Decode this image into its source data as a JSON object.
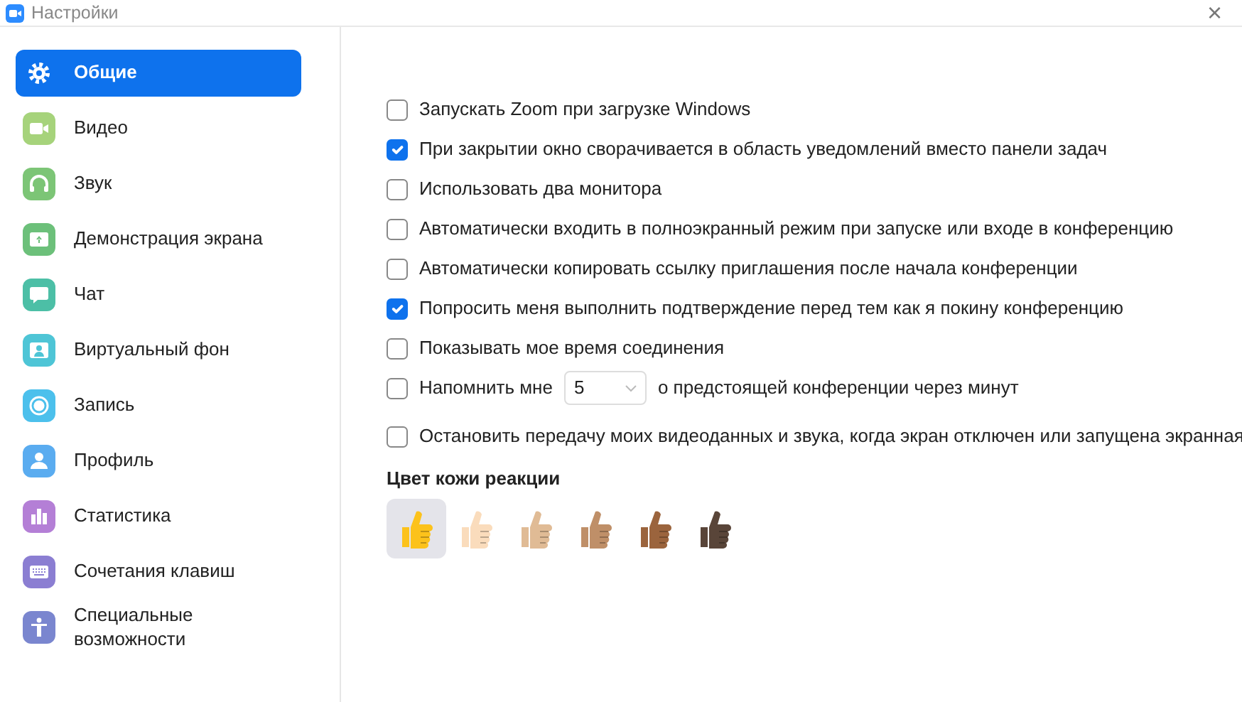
{
  "window": {
    "title": "Настройки",
    "close": "×"
  },
  "sidebar": {
    "items": [
      {
        "label": "Общие",
        "color": "#0e72ed",
        "selected": true
      },
      {
        "label": "Видео",
        "color": "#a6d37b",
        "selected": false
      },
      {
        "label": "Звук",
        "color": "#7cc576",
        "selected": false
      },
      {
        "label": "Демонстрация экрана",
        "color": "#6cc07a",
        "selected": false
      },
      {
        "label": "Чат",
        "color": "#4cbfa6",
        "selected": false
      },
      {
        "label": "Виртуальный фон",
        "color": "#4ec5d6",
        "selected": false
      },
      {
        "label": "Запись",
        "color": "#4cc0ec",
        "selected": false
      },
      {
        "label": "Профиль",
        "color": "#5aacf0",
        "selected": false
      },
      {
        "label": "Статистика",
        "color": "#b47fd6",
        "selected": false
      },
      {
        "label": "Сочетания клавиш",
        "color": "#8b7ed2",
        "selected": false
      },
      {
        "label": "Специальные возможности",
        "color": "#7a86cf",
        "selected": false
      }
    ]
  },
  "options": [
    {
      "kind": "check",
      "label": "Запускать Zoom при загрузке Windows",
      "checked": false
    },
    {
      "kind": "check",
      "label": "При закрытии окно сворачивается в область уведомлений вместо панели задач",
      "checked": true
    },
    {
      "kind": "check",
      "label": "Использовать два монитора",
      "checked": false
    },
    {
      "kind": "check",
      "label": "Автоматически входить в полноэкранный режим при запуске или входе в конференцию",
      "checked": false
    },
    {
      "kind": "check",
      "label": "Автоматически копировать ссылку приглашения после начала конференции",
      "checked": false
    },
    {
      "kind": "check",
      "label": "Попросить меня выполнить подтверждение перед тем как я покину конференцию",
      "checked": true
    },
    {
      "kind": "check",
      "label": "Показывать мое время соединения",
      "checked": false
    },
    {
      "kind": "reminder",
      "label": "Напомнить мне",
      "value": "5",
      "suffix": "о предстоящей конференции через минут",
      "checked": false
    },
    {
      "kind": "check",
      "label": "Остановить передачу моих видеоданных и звука, когда экран отключен или запущена экранная",
      "checked": false
    }
  ],
  "skin_tone": {
    "heading": "Цвет кожи реакции",
    "tones": [
      {
        "color": "#fcc21b",
        "selected": true
      },
      {
        "color": "#fadcbc",
        "selected": false
      },
      {
        "color": "#e0bb95",
        "selected": false
      },
      {
        "color": "#bf8f68",
        "selected": false
      },
      {
        "color": "#9b643d",
        "selected": false
      },
      {
        "color": "#594539",
        "selected": false
      }
    ]
  }
}
